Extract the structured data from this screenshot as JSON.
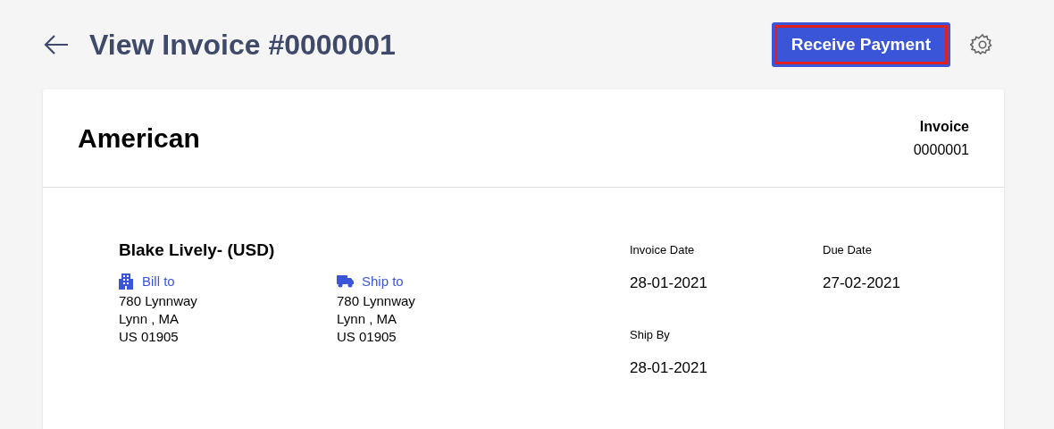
{
  "header": {
    "title": "View Invoice #0000001",
    "primary_button": {
      "label": "Receive Payment",
      "focused": true
    }
  },
  "invoice": {
    "company": "American",
    "label": "Invoice",
    "number": "0000001",
    "customer": "Blake Lively- (USD)",
    "addresses": [
      {
        "kind": "bill",
        "label": "Bill to",
        "lines": [
          "780 Lynnway",
          "Lynn , MA",
          "US 01905"
        ]
      },
      {
        "kind": "ship",
        "label": "Ship to",
        "lines": [
          "780 Lynnway",
          "Lynn , MA",
          "US 01905"
        ]
      }
    ],
    "dates": [
      {
        "label": "Invoice Date",
        "value": "28-01-2021"
      },
      {
        "label": "Due Date",
        "value": "27-02-2021"
      },
      {
        "label": "Ship By",
        "value": "28-01-2021"
      }
    ]
  }
}
